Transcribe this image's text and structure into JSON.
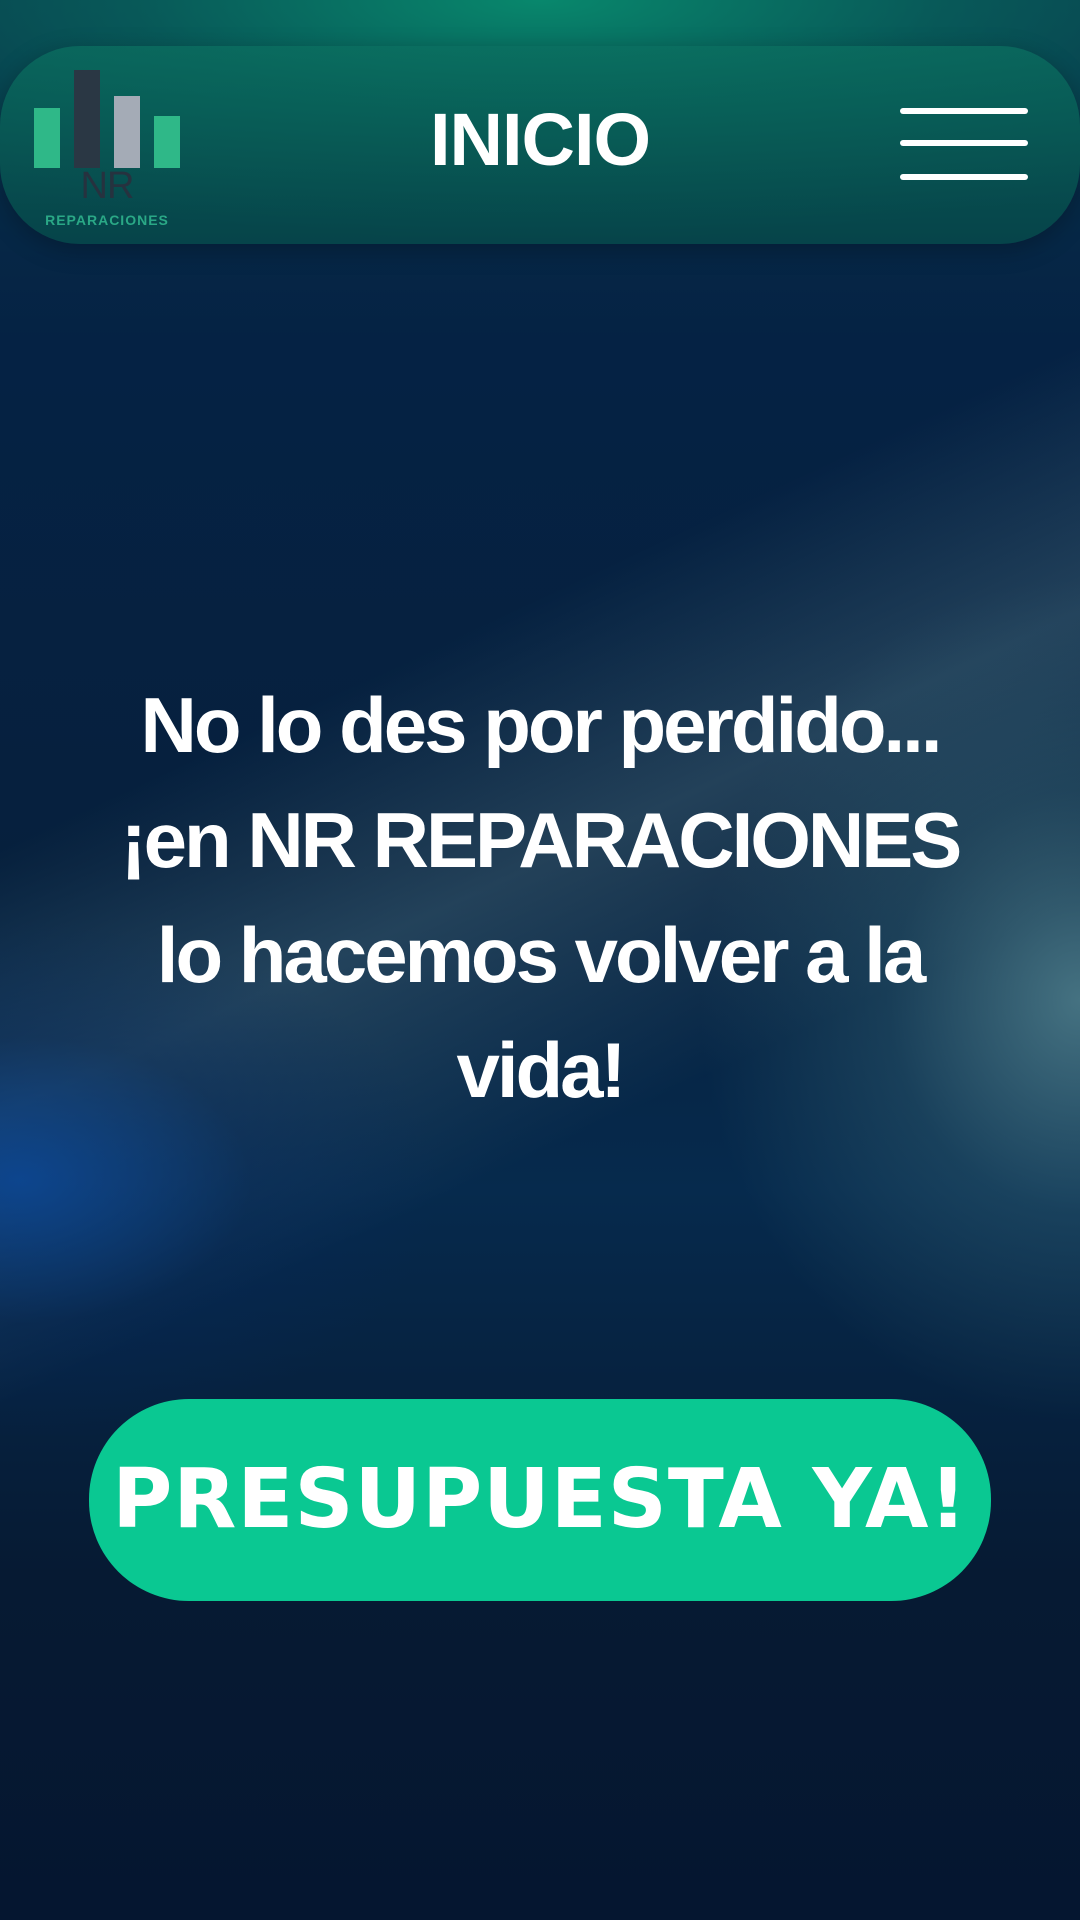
{
  "header": {
    "logo": {
      "monogram": "NR",
      "subtitle": "REPARACIONES",
      "bar_colors": [
        "#2fb888",
        "#2a3744",
        "#a4abb6",
        "#2fb888"
      ]
    },
    "title": "INICIO",
    "menu_icon": "hamburger-menu-icon"
  },
  "hero": {
    "headline": "No lo des por perdido... ¡en NR REPARACIONES lo hacemos volver a la vida!"
  },
  "cta": {
    "label": "PRESUPUESTA YA!"
  },
  "colors": {
    "accent": "#0ac892",
    "header_bg": "#0a6e5f",
    "page_bg": "#061a33",
    "text": "#ffffff"
  }
}
